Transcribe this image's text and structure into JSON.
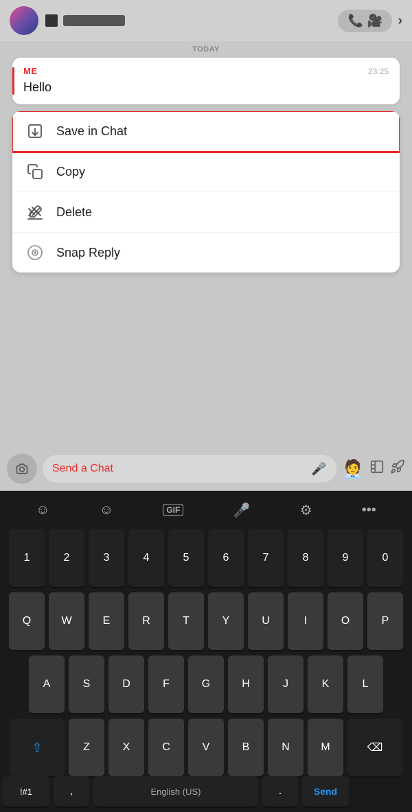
{
  "topBar": {
    "phoneIcon": "📞",
    "videoIcon": "🎥",
    "chevronIcon": "›"
  },
  "chat": {
    "todayLabel": "TODAY",
    "message": {
      "sender": "ME",
      "time": "23:25",
      "body": "Hello"
    }
  },
  "contextMenu": {
    "items": [
      {
        "id": "save-in-chat",
        "label": "Save in Chat",
        "highlighted": true
      },
      {
        "id": "copy",
        "label": "Copy",
        "highlighted": false
      },
      {
        "id": "delete",
        "label": "Delete",
        "highlighted": false
      },
      {
        "id": "snap-reply",
        "label": "Snap Reply",
        "highlighted": false
      }
    ]
  },
  "inputBar": {
    "placeholder": "Send a Chat"
  },
  "keyboard": {
    "rows": {
      "numbers": [
        "1",
        "2",
        "3",
        "4",
        "5",
        "6",
        "7",
        "8",
        "9",
        "0"
      ],
      "qwerty": [
        "Q",
        "W",
        "E",
        "R",
        "T",
        "Y",
        "U",
        "I",
        "O",
        "P"
      ],
      "asdf": [
        "A",
        "S",
        "D",
        "F",
        "G",
        "H",
        "J",
        "K",
        "L"
      ],
      "zxcv": [
        "Z",
        "X",
        "C",
        "V",
        "B",
        "N",
        "M"
      ],
      "bottom": [
        "!#1",
        ",",
        "English (US)",
        ".",
        "Send"
      ]
    }
  }
}
